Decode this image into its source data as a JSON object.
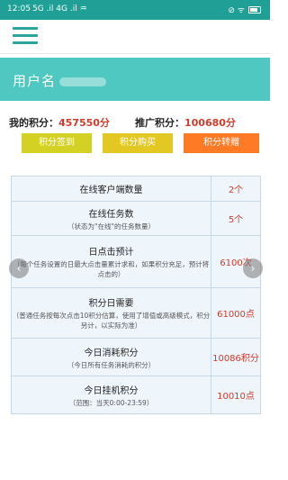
{
  "statusbar": {
    "time": "12:05",
    "signal": "5G .il 4G .il ♒",
    "right_icons": "⊘ ᯤ"
  },
  "header": {
    "menu_icon": "hamburger-menu-icon"
  },
  "banner": {
    "user_label": "用户名"
  },
  "points": {
    "my_label": "我的积分：",
    "my_value": "457550分",
    "promo_label": "推广积分：",
    "promo_value": "100680分"
  },
  "buttons": {
    "sign": "积分签到",
    "buy": "积分购买",
    "transfer": "积分转赠"
  },
  "table": {
    "rows": [
      {
        "title": "在线客户端数量",
        "sub": "",
        "value": "2个"
      },
      {
        "title": "在线任务数",
        "sub": "（状态为\"在线\"的任务数量）",
        "value": "5个"
      },
      {
        "title": "日点击预计",
        "sub": "（每个任务设置的日最大点击量累计求和，如果积分充足，预计将点击的）",
        "value": "6100次"
      },
      {
        "title": "积分日需要",
        "sub": "（普通任务按每次点击10积分估算，使用了增值或高级模式，积分另计，以实际为准）",
        "value": "61000点"
      },
      {
        "title": "今日消耗积分",
        "sub": "（今日所有任务消耗的积分）",
        "value": "10086积分"
      },
      {
        "title": "今日挂机积分",
        "sub": "（范围：当天0:00-23:59）",
        "value": "10010点"
      }
    ]
  },
  "nav": {
    "left": "‹",
    "right": "›"
  }
}
